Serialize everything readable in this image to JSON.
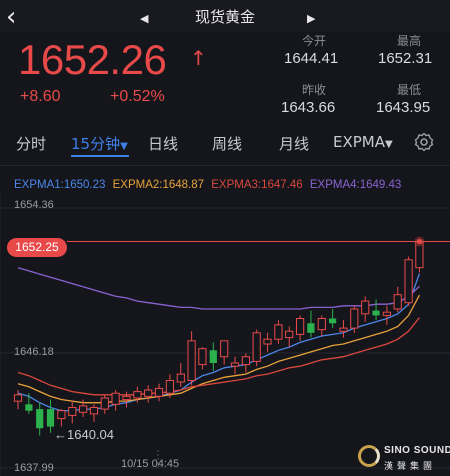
{
  "header": {
    "back_icon": "chevron-left-icon",
    "title": "现货黄金",
    "prev_icon": "triangle-left-icon",
    "next_icon": "triangle-right-icon"
  },
  "quote": {
    "price": "1652.26",
    "trend_icon": "arrow-up-icon",
    "change": "+8.60",
    "change_pct": "+0.52%",
    "stats": [
      {
        "label": "今开",
        "value": "1644.41"
      },
      {
        "label": "最高",
        "value": "1652.31"
      },
      {
        "label": "昨收",
        "value": "1643.66"
      },
      {
        "label": "最低",
        "value": "1643.95"
      }
    ]
  },
  "tabs": [
    {
      "label": "分时",
      "active": false
    },
    {
      "label": "15分钟",
      "active": true,
      "dropdown": true
    },
    {
      "label": "日线",
      "active": false
    },
    {
      "label": "周线",
      "active": false
    },
    {
      "label": "月线",
      "active": false
    },
    {
      "label": "EXPMA",
      "active": false,
      "dropdown": true
    }
  ],
  "settings_icon": "gear-icon",
  "colors": {
    "up": "#e84a4a",
    "down": "#2bb24c",
    "accent": "#3e7fe8",
    "expma1": "#4a86e8",
    "expma2": "#e8a23a",
    "expma3": "#d9483e",
    "expma4": "#8a63d2"
  },
  "legend": [
    {
      "label": "EXPMA1:1650.23"
    },
    {
      "label": "EXPMA2:1648.87"
    },
    {
      "label": "EXPMA3:1647.46"
    },
    {
      "label": "EXPMA4:1649.43"
    }
  ],
  "chart_data": {
    "type": "candlestick",
    "y_labels": [
      "1654.36",
      "1646.18",
      "1637.99"
    ],
    "ylim": [
      1637.99,
      1654.36
    ],
    "last_price_badge": "1652.25",
    "min_annotation": "←1640.04",
    "x_label": "10/15 04:45",
    "candles": [
      {
        "o": 1642.2,
        "h": 1642.9,
        "l": 1641.7,
        "c": 1642.6
      },
      {
        "o": 1642.0,
        "h": 1642.7,
        "l": 1641.4,
        "c": 1641.6
      },
      {
        "o": 1641.7,
        "h": 1642.1,
        "l": 1640.04,
        "c": 1640.5
      },
      {
        "o": 1641.7,
        "h": 1642.3,
        "l": 1640.2,
        "c": 1640.6
      },
      {
        "o": 1641.1,
        "h": 1641.7,
        "l": 1640.6,
        "c": 1641.6
      },
      {
        "o": 1641.3,
        "h": 1642.2,
        "l": 1640.8,
        "c": 1641.8
      },
      {
        "o": 1641.5,
        "h": 1642.3,
        "l": 1641.2,
        "c": 1641.9
      },
      {
        "o": 1641.4,
        "h": 1642.0,
        "l": 1640.9,
        "c": 1641.8
      },
      {
        "o": 1641.7,
        "h": 1642.6,
        "l": 1641.4,
        "c": 1642.4
      },
      {
        "o": 1642.0,
        "h": 1642.9,
        "l": 1641.6,
        "c": 1642.7
      },
      {
        "o": 1642.3,
        "h": 1642.8,
        "l": 1641.8,
        "c": 1642.5
      },
      {
        "o": 1642.4,
        "h": 1643.1,
        "l": 1642.1,
        "c": 1642.8
      },
      {
        "o": 1642.5,
        "h": 1643.2,
        "l": 1642.1,
        "c": 1642.9
      },
      {
        "o": 1642.5,
        "h": 1643.3,
        "l": 1642.2,
        "c": 1643.0
      },
      {
        "o": 1642.7,
        "h": 1643.9,
        "l": 1642.4,
        "c": 1643.5
      },
      {
        "o": 1643.4,
        "h": 1644.6,
        "l": 1643.1,
        "c": 1643.9
      },
      {
        "o": 1643.5,
        "h": 1646.6,
        "l": 1643.2,
        "c": 1646.0
      },
      {
        "o": 1644.5,
        "h": 1645.6,
        "l": 1644.2,
        "c": 1645.5
      },
      {
        "o": 1645.4,
        "h": 1645.9,
        "l": 1644.1,
        "c": 1644.6
      },
      {
        "o": 1645.0,
        "h": 1646.0,
        "l": 1644.5,
        "c": 1646.0
      },
      {
        "o": 1644.4,
        "h": 1645.0,
        "l": 1643.9,
        "c": 1644.6
      },
      {
        "o": 1644.5,
        "h": 1645.2,
        "l": 1644.0,
        "c": 1645.0
      },
      {
        "o": 1644.7,
        "h": 1646.7,
        "l": 1644.4,
        "c": 1646.5
      },
      {
        "o": 1645.8,
        "h": 1646.5,
        "l": 1645.3,
        "c": 1646.1
      },
      {
        "o": 1646.1,
        "h": 1647.3,
        "l": 1645.8,
        "c": 1647.0
      },
      {
        "o": 1646.2,
        "h": 1646.9,
        "l": 1645.6,
        "c": 1646.6
      },
      {
        "o": 1646.4,
        "h": 1647.6,
        "l": 1646.0,
        "c": 1647.4
      },
      {
        "o": 1647.1,
        "h": 1647.9,
        "l": 1646.2,
        "c": 1646.5
      },
      {
        "o": 1646.7,
        "h": 1647.6,
        "l": 1646.3,
        "c": 1647.4
      },
      {
        "o": 1647.4,
        "h": 1648.0,
        "l": 1646.8,
        "c": 1647.1
      },
      {
        "o": 1646.6,
        "h": 1647.3,
        "l": 1646.2,
        "c": 1646.8
      },
      {
        "o": 1646.8,
        "h": 1648.2,
        "l": 1646.5,
        "c": 1648.0
      },
      {
        "o": 1647.7,
        "h": 1648.8,
        "l": 1647.2,
        "c": 1648.5
      },
      {
        "o": 1647.9,
        "h": 1648.6,
        "l": 1647.3,
        "c": 1647.6
      },
      {
        "o": 1647.6,
        "h": 1648.2,
        "l": 1647.0,
        "c": 1647.8
      },
      {
        "o": 1648.0,
        "h": 1649.4,
        "l": 1647.8,
        "c": 1648.9
      },
      {
        "o": 1648.4,
        "h": 1651.3,
        "l": 1648.2,
        "c": 1651.1
      },
      {
        "o": 1650.6,
        "h": 1652.31,
        "l": 1650.3,
        "c": 1652.25
      }
    ],
    "expma": [
      {
        "name": "EXPMA1",
        "values": [
          1642.7,
          1642.5,
          1642.1,
          1641.8,
          1641.6,
          1641.6,
          1641.7,
          1641.7,
          1641.8,
          1642.0,
          1642.1,
          1642.3,
          1642.4,
          1642.5,
          1642.7,
          1642.9,
          1643.4,
          1643.8,
          1644.0,
          1644.3,
          1644.4,
          1644.5,
          1644.8,
          1645.1,
          1645.4,
          1645.6,
          1645.9,
          1646.1,
          1646.3,
          1646.4,
          1646.5,
          1646.8,
          1647.0,
          1647.2,
          1647.4,
          1647.7,
          1648.3,
          1650.23
        ]
      },
      {
        "name": "EXPMA2",
        "values": [
          1643.3,
          1643.1,
          1642.8,
          1642.5,
          1642.3,
          1642.2,
          1642.1,
          1642.1,
          1642.1,
          1642.2,
          1642.2,
          1642.3,
          1642.4,
          1642.5,
          1642.6,
          1642.7,
          1643.0,
          1643.3,
          1643.5,
          1643.7,
          1643.8,
          1643.9,
          1644.2,
          1644.4,
          1644.7,
          1644.9,
          1645.1,
          1645.3,
          1645.5,
          1645.7,
          1645.8,
          1646.0,
          1646.2,
          1646.4,
          1646.6,
          1646.9,
          1647.6,
          1648.87
        ]
      },
      {
        "name": "EXPMA3",
        "values": [
          1644.0,
          1643.8,
          1643.5,
          1643.2,
          1643.0,
          1642.8,
          1642.7,
          1642.6,
          1642.6,
          1642.6,
          1642.6,
          1642.6,
          1642.7,
          1642.7,
          1642.8,
          1642.9,
          1643.1,
          1643.2,
          1643.3,
          1643.4,
          1643.5,
          1643.6,
          1643.8,
          1643.9,
          1644.1,
          1644.3,
          1644.4,
          1644.6,
          1644.8,
          1644.9,
          1645.0,
          1645.2,
          1645.4,
          1645.6,
          1645.8,
          1646.1,
          1646.6,
          1647.46
        ]
      },
      {
        "name": "EXPMA4",
        "values": [
          1650.6,
          1650.4,
          1650.2,
          1650.0,
          1649.8,
          1649.6,
          1649.4,
          1649.2,
          1649.0,
          1648.8,
          1648.7,
          1648.5,
          1648.4,
          1648.3,
          1648.2,
          1648.1,
          1648.1,
          1648.0,
          1648.0,
          1648.0,
          1648.0,
          1648.0,
          1648.0,
          1648.0,
          1648.0,
          1648.0,
          1648.0,
          1648.1,
          1648.1,
          1648.1,
          1648.2,
          1648.2,
          1648.2,
          1648.3,
          1648.3,
          1648.4,
          1648.8,
          1649.43
        ]
      }
    ]
  },
  "logo": {
    "brand_en": "SINO SOUND",
    "brand_cn": "漢聲集團"
  }
}
